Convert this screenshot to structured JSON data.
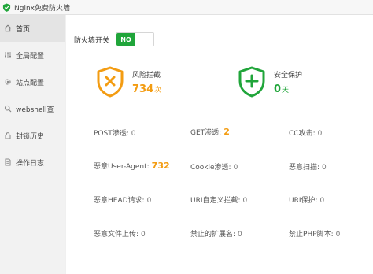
{
  "window": {
    "title": "Nginx免费防火墙"
  },
  "sidebar": {
    "items": [
      {
        "label": "首页",
        "icon": "home-icon"
      },
      {
        "label": "全局配置",
        "icon": "sliders-icon"
      },
      {
        "label": "站点配置",
        "icon": "gear-icon"
      },
      {
        "label": "webshell查",
        "icon": "search-icon"
      },
      {
        "label": "封锁历史",
        "icon": "lock-icon"
      },
      {
        "label": "操作日志",
        "icon": "document-icon"
      }
    ],
    "active_index": 0
  },
  "firewall": {
    "label": "防火墙开关",
    "toggle_text": "NO"
  },
  "stats": {
    "block": {
      "label": "风险拦截",
      "value": "734",
      "unit": "次"
    },
    "protect": {
      "label": "安全保护",
      "value": "0",
      "unit": "天"
    }
  },
  "metrics": [
    {
      "label": "POST渗透:",
      "value": "0"
    },
    {
      "label": "GET渗透:",
      "value": "2"
    },
    {
      "label": "CC攻击:",
      "value": "0"
    },
    {
      "label": "恶意User-Agent:",
      "value": "732"
    },
    {
      "label": "Cookie渗透:",
      "value": "0"
    },
    {
      "label": "恶意扫描:",
      "value": "0"
    },
    {
      "label": "恶意HEAD请求:",
      "value": "0"
    },
    {
      "label": "URI自定义拦截:",
      "value": "0"
    },
    {
      "label": "URI保护:",
      "value": "0"
    },
    {
      "label": "恶意文件上传:",
      "value": "0"
    },
    {
      "label": "禁止的扩展名:",
      "value": "0"
    },
    {
      "label": "禁止PHP脚本:",
      "value": "0"
    }
  ],
  "colors": {
    "accent": "#20a53a",
    "warning": "#f39c12"
  }
}
